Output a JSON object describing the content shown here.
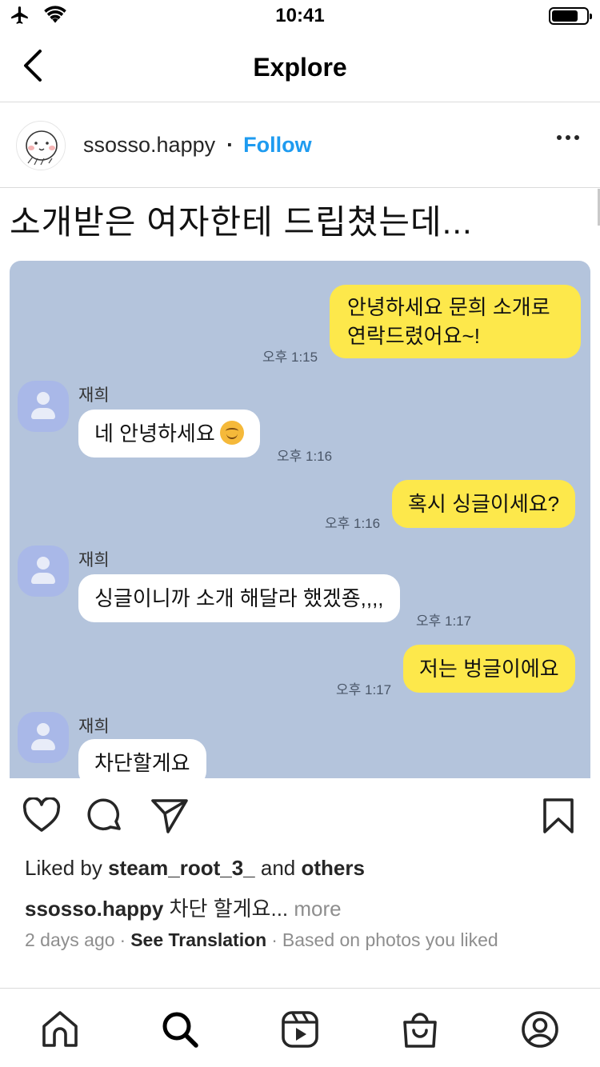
{
  "status_bar": {
    "time": "10:41",
    "battery_level": 0.75
  },
  "header": {
    "title": "Explore",
    "back_icon": "chevron-left-icon"
  },
  "post": {
    "username": "ssosso.happy",
    "separator": "·",
    "follow_label": "Follow",
    "more_icon": "ellipsis-icon",
    "image": {
      "headline": "소개받은 여자한테 드립쳤는데...",
      "messages": [
        {
          "from": "me",
          "text_line1": "안녕하세요 문희 소개로",
          "text_line2": "연락드렸어요~!",
          "time": "오후 1:15"
        },
        {
          "from": "them",
          "sender": "재희",
          "text": "네 안녕하세요",
          "emoji": "smiling-face-icon",
          "time": "오후 1:16"
        },
        {
          "from": "me",
          "text": "혹시 싱글이세요?",
          "time": "오후 1:16"
        },
        {
          "from": "them",
          "sender": "재희",
          "text": "싱글이니까 소개 해달라 했겠죵,,,,",
          "time": "오후 1:17"
        },
        {
          "from": "me",
          "text": "저는 벙글이에요",
          "time": "오후 1:17"
        },
        {
          "from": "them",
          "sender": "재희",
          "text": "차단할게요"
        }
      ]
    },
    "actions": {
      "like_icon": "heart-icon",
      "comment_icon": "comment-icon",
      "share_icon": "paper-plane-icon",
      "save_icon": "bookmark-icon"
    },
    "likes": {
      "prefix": "Liked by",
      "user": "steam_root_3_",
      "conjunction": "and",
      "others": "others"
    },
    "caption": {
      "username": "ssosso.happy",
      "text": "차단 할게요...",
      "more_label": "more"
    },
    "meta": {
      "time_ago": "2 days ago",
      "separator": "·",
      "see_translation": "See Translation",
      "reason": "Based on photos you liked"
    }
  },
  "tab_bar": {
    "items": [
      "home-icon",
      "search-icon",
      "reels-icon",
      "shop-icon",
      "profile-icon"
    ]
  },
  "colors": {
    "accent": "#1e9bf0",
    "chat_background": "#b4c4dc",
    "my_bubble": "#fde84b",
    "their_bubble": "#ffffff"
  }
}
